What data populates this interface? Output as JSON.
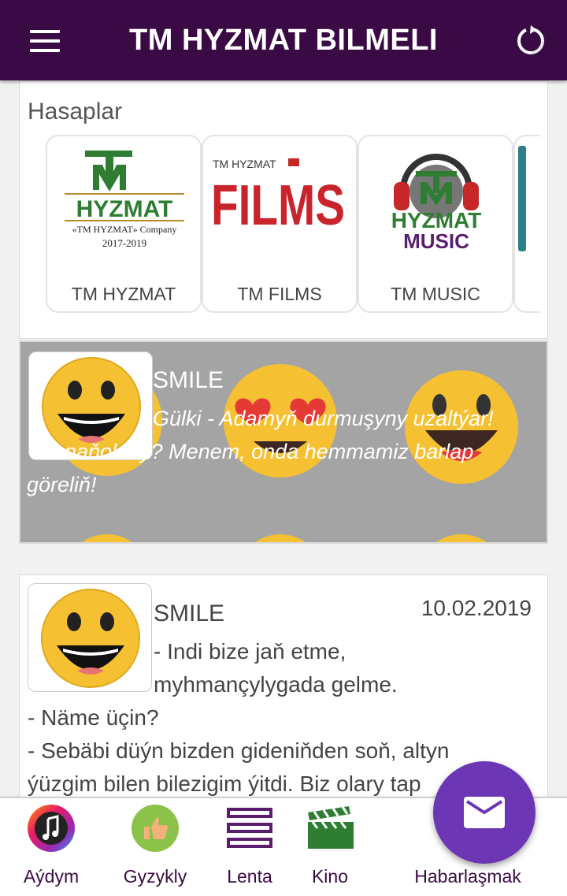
{
  "header": {
    "title": "TM HYZMAT BILMELI",
    "menu_icon": "hamburger-icon",
    "refresh_icon": "refresh-icon"
  },
  "accounts": {
    "title": "Hasaplar",
    "items": [
      {
        "label": "TM HYZMAT",
        "logo_text": "HYZMAT",
        "logo_sub": "«TM HYZMAT» Company",
        "logo_years": "2017-2019"
      },
      {
        "label": "TM FILMS",
        "logo_text": "FILMS",
        "logo_sub": "TM HYZMAT"
      },
      {
        "label": "TM MUSIC",
        "logo_text": "HYZMAT",
        "logo_sub": "MUSIC"
      }
    ]
  },
  "featured": {
    "name": "SMILE",
    "text": "Gülki - Adamyň durmuşyny uzaltýar! Ynanaňokmy? Menem, onda hemmamiz barlap göreliň!"
  },
  "post": {
    "name": "SMILE",
    "date": "10.02.2019",
    "lines": [
      "- Indi bize jaň etme,",
      "myhmançylygada gelme.",
      "- Näme üçin?",
      "- Sebäbi düýn bizden gideniňden soň, altyn",
      "ýüzgim bilen bilezigim ýitdi. Biz olary tap"
    ]
  },
  "bottom_nav": [
    {
      "label": "Aýdym",
      "icon": "music-note-icon"
    },
    {
      "label": "Gyzykly",
      "icon": "thumbs-up-icon"
    },
    {
      "label": "Lenta",
      "icon": "list-icon"
    },
    {
      "label": "Kino",
      "icon": "clapperboard-icon"
    },
    {
      "label": "Habarlaşmak",
      "icon": "mail-icon"
    }
  ],
  "colors": {
    "primary": "#3a0a44",
    "fab": "#6c36b4",
    "emoji_yellow": "#f5c132"
  }
}
